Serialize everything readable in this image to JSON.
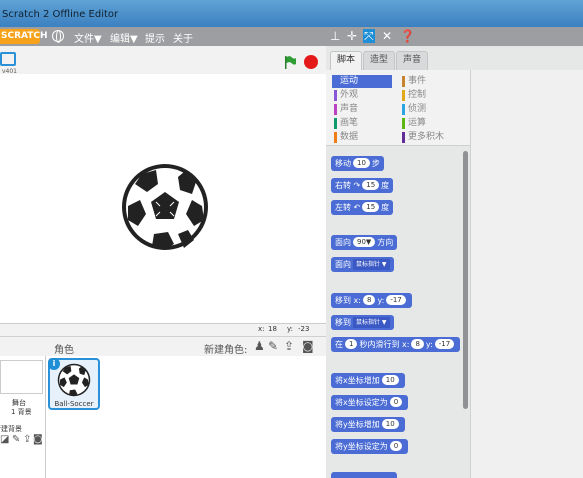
{
  "window": {
    "title": "Scratch 2 Offline Editor"
  },
  "menubar": {
    "logo": "SCRATCH",
    "items": [
      "文件▼",
      "编辑▼",
      "提示",
      "关于"
    ]
  },
  "stage": {
    "version": "v401",
    "x_label": "x:",
    "x_value": "18",
    "y_label": "y:",
    "y_value": "-23"
  },
  "sprites": {
    "header_label": "角色",
    "new_sprite_label": "新建角色:",
    "stage_label": "舞台",
    "backdrop_count": "1 背景",
    "new_backdrop_label": "新建背景",
    "items": [
      {
        "name": "Ball-Soccer"
      }
    ]
  },
  "tabs": [
    "脚本",
    "造型",
    "声音"
  ],
  "categories": [
    {
      "label": "运动",
      "color": "#4a6cd4",
      "selected": true
    },
    {
      "label": "外观",
      "color": "#8a55d7",
      "selected": false
    },
    {
      "label": "声音",
      "color": "#bb42c3",
      "selected": false
    },
    {
      "label": "画笔",
      "color": "#0e9a6c",
      "selected": false
    },
    {
      "label": "数据",
      "color": "#ee7d16",
      "selected": false
    },
    {
      "label": "事件",
      "color": "#c88330",
      "selected": false
    },
    {
      "label": "控制",
      "color": "#e1a91a",
      "selected": false
    },
    {
      "label": "侦测",
      "color": "#2ca5e2",
      "selected": false
    },
    {
      "label": "运算",
      "color": "#5cb712",
      "selected": false
    },
    {
      "label": "更多积木",
      "color": "#632d99",
      "selected": false
    }
  ],
  "blocks": {
    "move": {
      "pre": "移动",
      "val": "10",
      "post": "步"
    },
    "turn_right": {
      "pre": "右转",
      "icon": "↷",
      "val": "15",
      "post": "度"
    },
    "turn_left": {
      "pre": "左转",
      "icon": "↶",
      "val": "15",
      "post": "度"
    },
    "point_dir": {
      "pre": "面向",
      "val": "90▼",
      "post": "方向"
    },
    "point_toward": {
      "pre": "面向",
      "dd": "鼠标指针 ▼"
    },
    "goto_xy": {
      "pre": "移到 x:",
      "x": "8",
      "mid": "y:",
      "y": "-17"
    },
    "goto": {
      "pre": "移到",
      "dd": "鼠标指针 ▼"
    },
    "glide": {
      "pre": "在",
      "secs": "1",
      "mid": "秒内滑行到 x:",
      "x": "8",
      "ylbl": "y:",
      "y": "-17"
    },
    "change_x": {
      "pre": "将x坐标增加",
      "val": "10"
    },
    "set_x": {
      "pre": "将x坐标设定为",
      "val": "0"
    },
    "change_y": {
      "pre": "将y坐标增加",
      "val": "10"
    },
    "set_y": {
      "pre": "将y坐标设定为",
      "val": "0"
    }
  },
  "colors": {
    "motion": "#4a6cd4",
    "menubar": "#9c9ea2",
    "stop": "#e41a1a",
    "flag": "#2e9e34"
  }
}
